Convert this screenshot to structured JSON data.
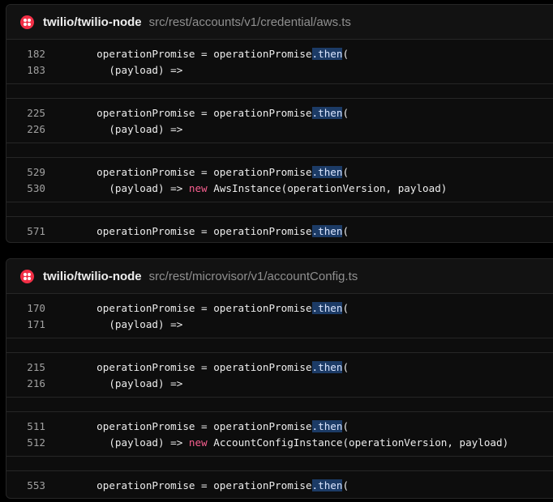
{
  "results": [
    {
      "repo": "twilio/twilio-node",
      "path": "src/rest/accounts/v1/credential/aws.ts",
      "blocks": [
        [
          {
            "num": "182",
            "segments": [
              {
                "t": "  operationPromise = operationPromise",
                "c": ""
              },
              {
                "t": ".then",
                "c": "hl"
              },
              {
                "t": "(",
                "c": ""
              }
            ]
          },
          {
            "num": "183",
            "segments": [
              {
                "t": "    (payload) =>",
                "c": ""
              }
            ]
          }
        ],
        [
          {
            "num": "225",
            "segments": [
              {
                "t": "  operationPromise = operationPromise",
                "c": ""
              },
              {
                "t": ".then",
                "c": "hl"
              },
              {
                "t": "(",
                "c": ""
              }
            ]
          },
          {
            "num": "226",
            "segments": [
              {
                "t": "    (payload) =>",
                "c": ""
              }
            ]
          }
        ],
        [
          {
            "num": "529",
            "segments": [
              {
                "t": "  operationPromise = operationPromise",
                "c": ""
              },
              {
                "t": ".then",
                "c": "hl"
              },
              {
                "t": "(",
                "c": ""
              }
            ]
          },
          {
            "num": "530",
            "segments": [
              {
                "t": "    (payload) => ",
                "c": ""
              },
              {
                "t": "new",
                "c": "kw"
              },
              {
                "t": " AwsInstance(operationVersion, payload)",
                "c": ""
              }
            ]
          }
        ],
        [
          {
            "num": "571",
            "segments": [
              {
                "t": "  operationPromise = operationPromise",
                "c": ""
              },
              {
                "t": ".then",
                "c": "hl"
              },
              {
                "t": "(",
                "c": ""
              }
            ]
          }
        ]
      ]
    },
    {
      "repo": "twilio/twilio-node",
      "path": "src/rest/microvisor/v1/accountConfig.ts",
      "blocks": [
        [
          {
            "num": "170",
            "segments": [
              {
                "t": "  operationPromise = operationPromise",
                "c": ""
              },
              {
                "t": ".then",
                "c": "hl"
              },
              {
                "t": "(",
                "c": ""
              }
            ]
          },
          {
            "num": "171",
            "segments": [
              {
                "t": "    (payload) =>",
                "c": ""
              }
            ]
          }
        ],
        [
          {
            "num": "215",
            "segments": [
              {
                "t": "  operationPromise = operationPromise",
                "c": ""
              },
              {
                "t": ".then",
                "c": "hl"
              },
              {
                "t": "(",
                "c": ""
              }
            ]
          },
          {
            "num": "216",
            "segments": [
              {
                "t": "    (payload) =>",
                "c": ""
              }
            ]
          }
        ],
        [
          {
            "num": "511",
            "segments": [
              {
                "t": "  operationPromise = operationPromise",
                "c": ""
              },
              {
                "t": ".then",
                "c": "hl"
              },
              {
                "t": "(",
                "c": ""
              }
            ]
          },
          {
            "num": "512",
            "segments": [
              {
                "t": "    (payload) => ",
                "c": ""
              },
              {
                "t": "new",
                "c": "kw"
              },
              {
                "t": " AccountConfigInstance(operationVersion, payload)",
                "c": ""
              }
            ]
          }
        ],
        [
          {
            "num": "553",
            "segments": [
              {
                "t": "  operationPromise = operationPromise",
                "c": ""
              },
              {
                "t": ".then",
                "c": "hl"
              },
              {
                "t": "(",
                "c": ""
              }
            ]
          }
        ]
      ]
    }
  ],
  "colors": {
    "brand": "#f22f46",
    "match_highlight": "#1c3b66",
    "keyword": "#f75f8f"
  },
  "icons": {
    "repo_logo": "twilio-logo-icon"
  }
}
